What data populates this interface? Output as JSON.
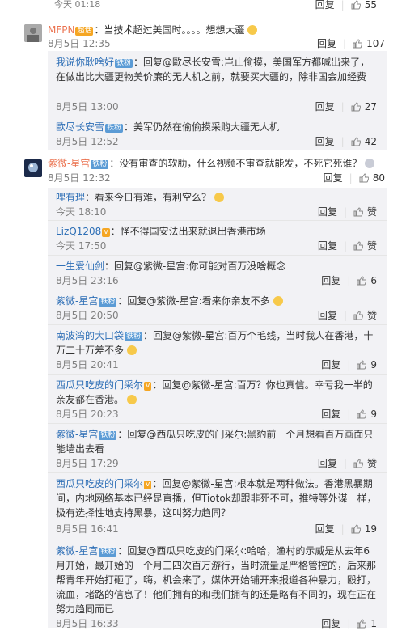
{
  "prev_footer": {
    "time": "今天 01:18",
    "reply": "回复",
    "likes": "55"
  },
  "comments": [
    {
      "user": "MFPN",
      "badge": "超话",
      "text": "：当技术超过美国时。。。。想想大疆",
      "time": "8月5日 12:35",
      "reply": "回复",
      "likes": "107",
      "replies": [
        {
          "user": "我说你耿啥好",
          "badge": "铁粉",
          "text": "：回复@歐尽长安雪:岂止偷摸，美国军方都喊出来了，在做出比大疆更物美价廉的无人机之前，就要买大疆的，除非国会加经费",
          "time": "8月5日 13:00",
          "reply": "回复",
          "likes": "27"
        },
        {
          "user": "歐尽长安雪",
          "badge": "铁粉",
          "text": "：美军仍然在偷偷摸采购大疆无人机",
          "time": "8月5日 12:52",
          "reply": "回复",
          "likes": "42"
        }
      ]
    },
    {
      "user": "紫微-星宫",
      "badge": "铁粉",
      "text": "：没有审查的软肋，什么视频不审查就能发，不死它死谁？",
      "time": "8月5日 12:32",
      "reply": "回复",
      "likes": "80",
      "replies": [
        {
          "user": "哩有理",
          "badge": "",
          "text": "：看来今日有难，有利空么？",
          "time": "今天 18:10",
          "reply": "回复",
          "likes": "赞"
        },
        {
          "user": "LizQ1208",
          "badge": "v",
          "text": "：怪不得国安法出来就退出香港市场",
          "time": "今天 17:50",
          "reply": "回复",
          "likes": "赞"
        },
        {
          "user": "一生爱仙剑",
          "badge": "",
          "text": "：回复@紫微-星宫:你可能对百万没啥概念",
          "time": "8月5日 23:16",
          "reply": "回复",
          "likes": "6"
        },
        {
          "user": "紫微-星宫",
          "badge": "铁粉",
          "text": "：回复@紫微-星宫:看来你亲友不多",
          "time": "8月5日 20:50",
          "reply": "回复",
          "likes": "赞"
        },
        {
          "user": "南波湾的大口袋",
          "badge": "铁粉",
          "text": "：回复@紫微-星宫:百万个毛线，当时我人在香港，十万二十万差不多",
          "time": "8月5日 20:41",
          "reply": "回复",
          "likes": "9"
        },
        {
          "user": "西瓜只吃皮的门采尔",
          "badge": "v",
          "text": "：回复@紫微-星宫:百万？你也真信。幸亏我一半的亲友都在香港。",
          "time": "8月5日 20:23",
          "reply": "回复",
          "likes": "9"
        },
        {
          "user": "紫微-星宫",
          "badge": "铁粉",
          "text": "：回复@西瓜只吃皮的门采尔:黑豹前一个月想看百万画面只能墙出去看",
          "time": "8月5日 17:29",
          "reply": "回复",
          "likes": "赞"
        },
        {
          "user": "西瓜只吃皮的门采尔",
          "badge": "v",
          "text": "：回复@紫微-星宫:根本就是两种做法。香港黑暴期间，内地网络基本已经是直播，但Tiotok却跟非死不可，推特等外谋一样，极有选择性地支持黑暴，这叫努力趋同？",
          "time": "8月5日 16:41",
          "reply": "回复",
          "likes": "19"
        },
        {
          "user": "紫微-星宫",
          "badge": "铁粉",
          "text": "：回复@西瓜只吃皮的门采尔:哈哈，渔村的示威是从去年6月开始，最开始的一个月三四次百万游行，当时流量是严格管控的，后来那帮青年开始打砸了，嗨，机会来了，媒体开始铺开来报道各种暴力，殴打，流血，堵路的信息了！他们拥有的和我们拥有的还是略有不同的，现在正在努力趋同而已",
          "time": "8月5日 16:33",
          "reply": "回复",
          "likes": "1"
        }
      ]
    }
  ]
}
